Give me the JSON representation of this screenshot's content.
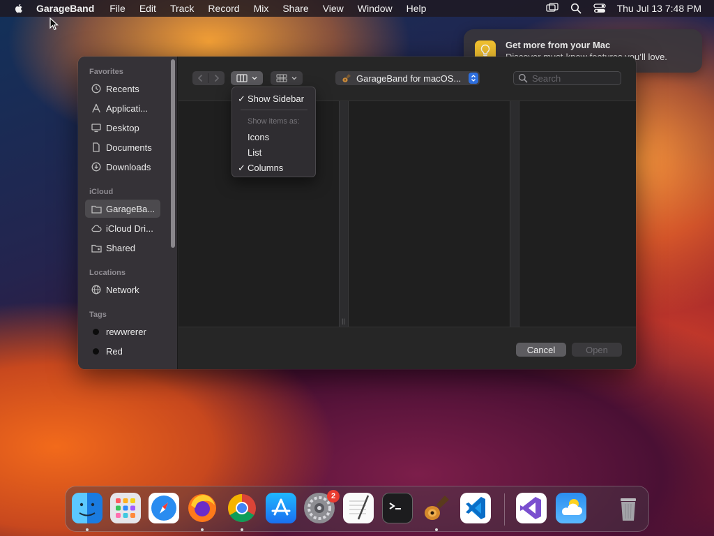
{
  "menubar": {
    "app_name": "GarageBand",
    "menus": [
      "File",
      "Edit",
      "Track",
      "Record",
      "Mix",
      "Share",
      "View",
      "Window",
      "Help"
    ],
    "clock": "Thu Jul 13  7:48 PM",
    "status_icons": [
      "screen-mirroring-icon",
      "spotlight-search-icon",
      "control-center-icon"
    ]
  },
  "notification": {
    "title": "Get more from your Mac",
    "body": "Discover must-know features you’ll love.",
    "icon": "lightbulb-icon"
  },
  "dialog": {
    "sidebar": {
      "favorites_title": "Favorites",
      "favorites": [
        {
          "label": "Recents",
          "icon": "clock-icon"
        },
        {
          "label": "Applicati...",
          "icon": "applications-icon"
        },
        {
          "label": "Desktop",
          "icon": "desktop-icon"
        },
        {
          "label": "Documents",
          "icon": "document-icon"
        },
        {
          "label": "Downloads",
          "icon": "downloads-icon"
        }
      ],
      "icloud_title": "iCloud",
      "icloud": [
        {
          "label": "GarageBa...",
          "icon": "folder-icon",
          "selected": true
        },
        {
          "label": "iCloud Dri...",
          "icon": "cloud-icon"
        },
        {
          "label": "Shared",
          "icon": "shared-folder-icon"
        }
      ],
      "locations_title": "Locations",
      "locations": [
        {
          "label": "Network",
          "icon": "network-globe-icon"
        }
      ],
      "tags_title": "Tags",
      "tags": [
        {
          "label": "rewwrerer",
          "color": "#0c0c0c"
        },
        {
          "label": "Red",
          "color": "#0c0c0c"
        }
      ]
    },
    "path_popup": "GarageBand for macOS...",
    "search_placeholder": "Search",
    "cancel_label": "Cancel",
    "open_label": "Open"
  },
  "view_menu": {
    "show_sidebar": "Show Sidebar",
    "show_items_as": "Show items as:",
    "icons": "Icons",
    "list": "List",
    "columns": "Columns",
    "checked": [
      "Show Sidebar",
      "Columns"
    ]
  },
  "dock": {
    "apps": [
      "Finder",
      "Launchpad",
      "Safari",
      "Firefox",
      "Chrome",
      "App Store",
      "System Settings",
      "TextEdit",
      "Terminal",
      "GarageBand",
      "Visual Studio Code",
      "Visual Studio",
      "Weather",
      "Trash"
    ],
    "system_settings_badge": "2"
  },
  "colors": {
    "accent": "#2e6fde",
    "badge": "#ea3b30",
    "tip": "#f6c431"
  }
}
